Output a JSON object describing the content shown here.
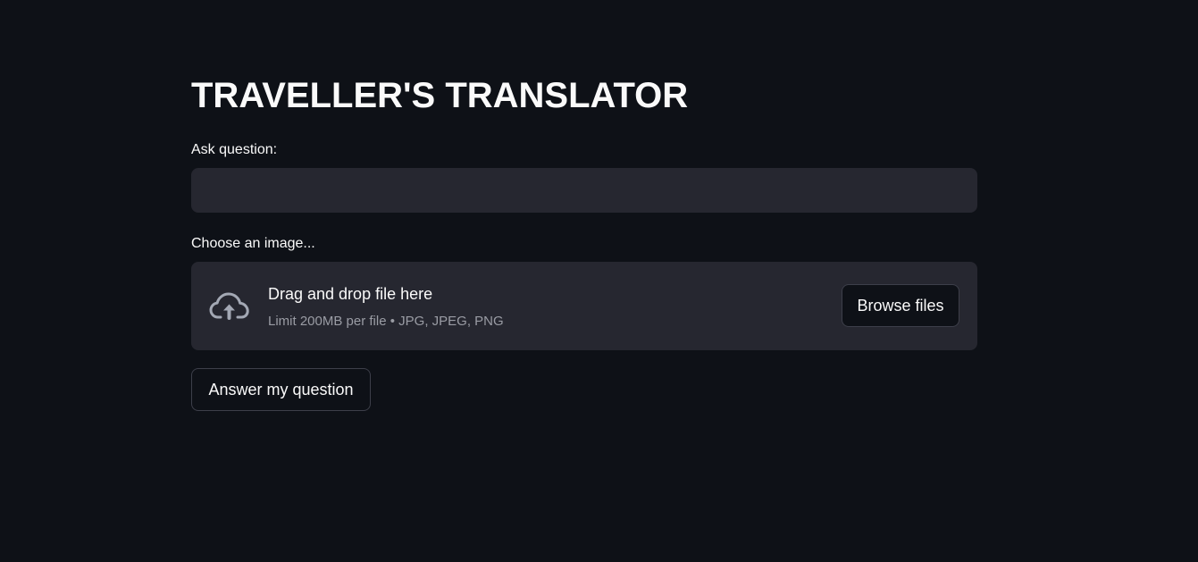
{
  "page": {
    "title": "TRAVELLER'S TRANSLATOR"
  },
  "question": {
    "label": "Ask question:",
    "value": "",
    "placeholder": ""
  },
  "uploader": {
    "label": "Choose an image...",
    "drop_title": "Drag and drop file here",
    "drop_hint": "Limit 200MB per file • JPG, JPEG, PNG",
    "browse_label": "Browse files",
    "icon": "cloud-upload-icon"
  },
  "actions": {
    "answer_label": "Answer my question"
  },
  "colors": {
    "background": "#0e1117",
    "surface": "#262730",
    "text": "#fafafa",
    "muted_text": "#9a9ca4",
    "border": "#3d3f4a"
  }
}
